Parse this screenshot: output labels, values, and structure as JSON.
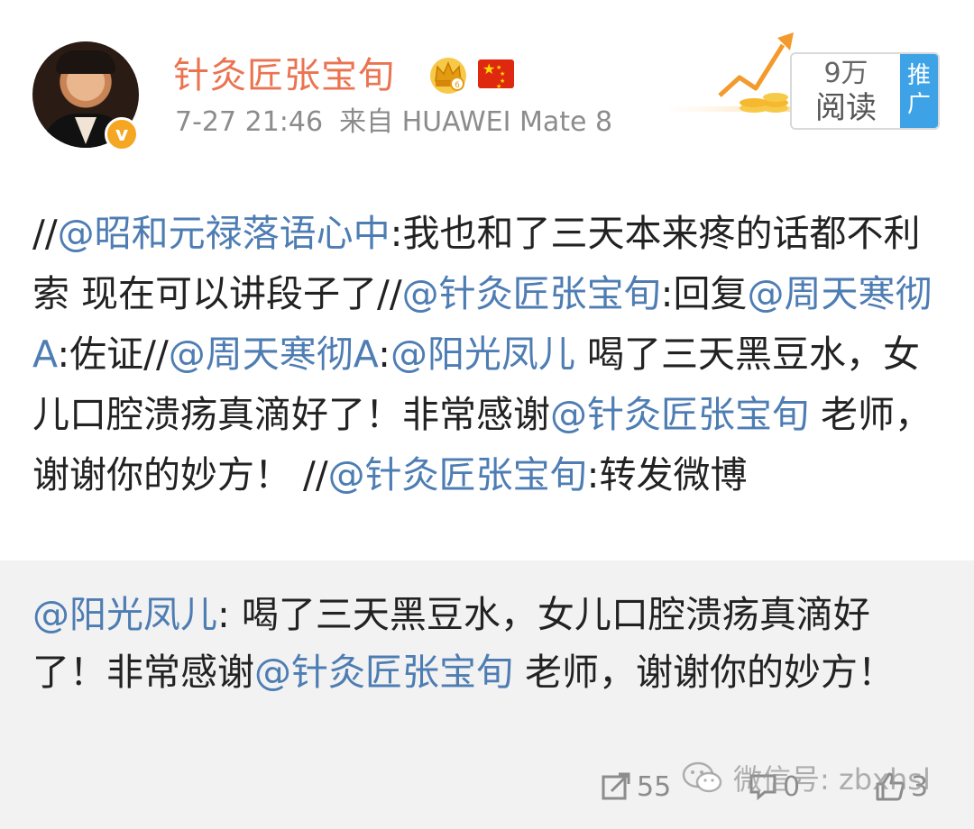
{
  "author": {
    "name": "针灸匠张宝旬",
    "verified_badge": "v",
    "timestamp": "7-27 21:46",
    "source": "来自 HUAWEI Mate 8"
  },
  "promo": {
    "count": "9万",
    "label": "阅读",
    "tag": "推广"
  },
  "post": {
    "s1": "//",
    "m1": "@昭和元禄落语心中",
    "s2": ":我也和了三天本来疼的话都不利索 现在可以讲段子了//",
    "m2": "@针灸匠张宝旬",
    "s3": ":回复",
    "m3": "@周天寒彻A",
    "s4": ":佐证//",
    "m4": "@周天寒彻A",
    "s5": ":",
    "m5": "@阳光凤儿",
    "s6": " 喝了三天黑豆水，女儿口腔溃疡真滴好了！非常感谢",
    "m6": "@针灸匠张宝旬",
    "s7": " 老师，谢谢你的妙方！ //",
    "m7": "@针灸匠张宝旬",
    "s8": ":转发微博"
  },
  "quote": {
    "m1": "@阳光凤儿",
    "s1": ": 喝了三天黑豆水，女儿口腔溃疡真滴好了！非常感谢",
    "m2": "@针灸匠张宝旬",
    "s2": " 老师，谢谢你的妙方！"
  },
  "footer": {
    "repost_count": "55",
    "comment_count": "0",
    "like_count": "3"
  },
  "watermark": "微信号: zbxhsl",
  "icons": [
    "crown-icon",
    "china-flag-icon",
    "repost-icon",
    "comment-icon",
    "like-icon",
    "wechat-icon"
  ],
  "colors": {
    "username": "#eb7350",
    "mention": "#4e7db3",
    "meta": "#8c8c8c",
    "promo_tag": "#3ea3e6",
    "quote_bg": "#f2f2f2",
    "verified": "#f5a623"
  }
}
